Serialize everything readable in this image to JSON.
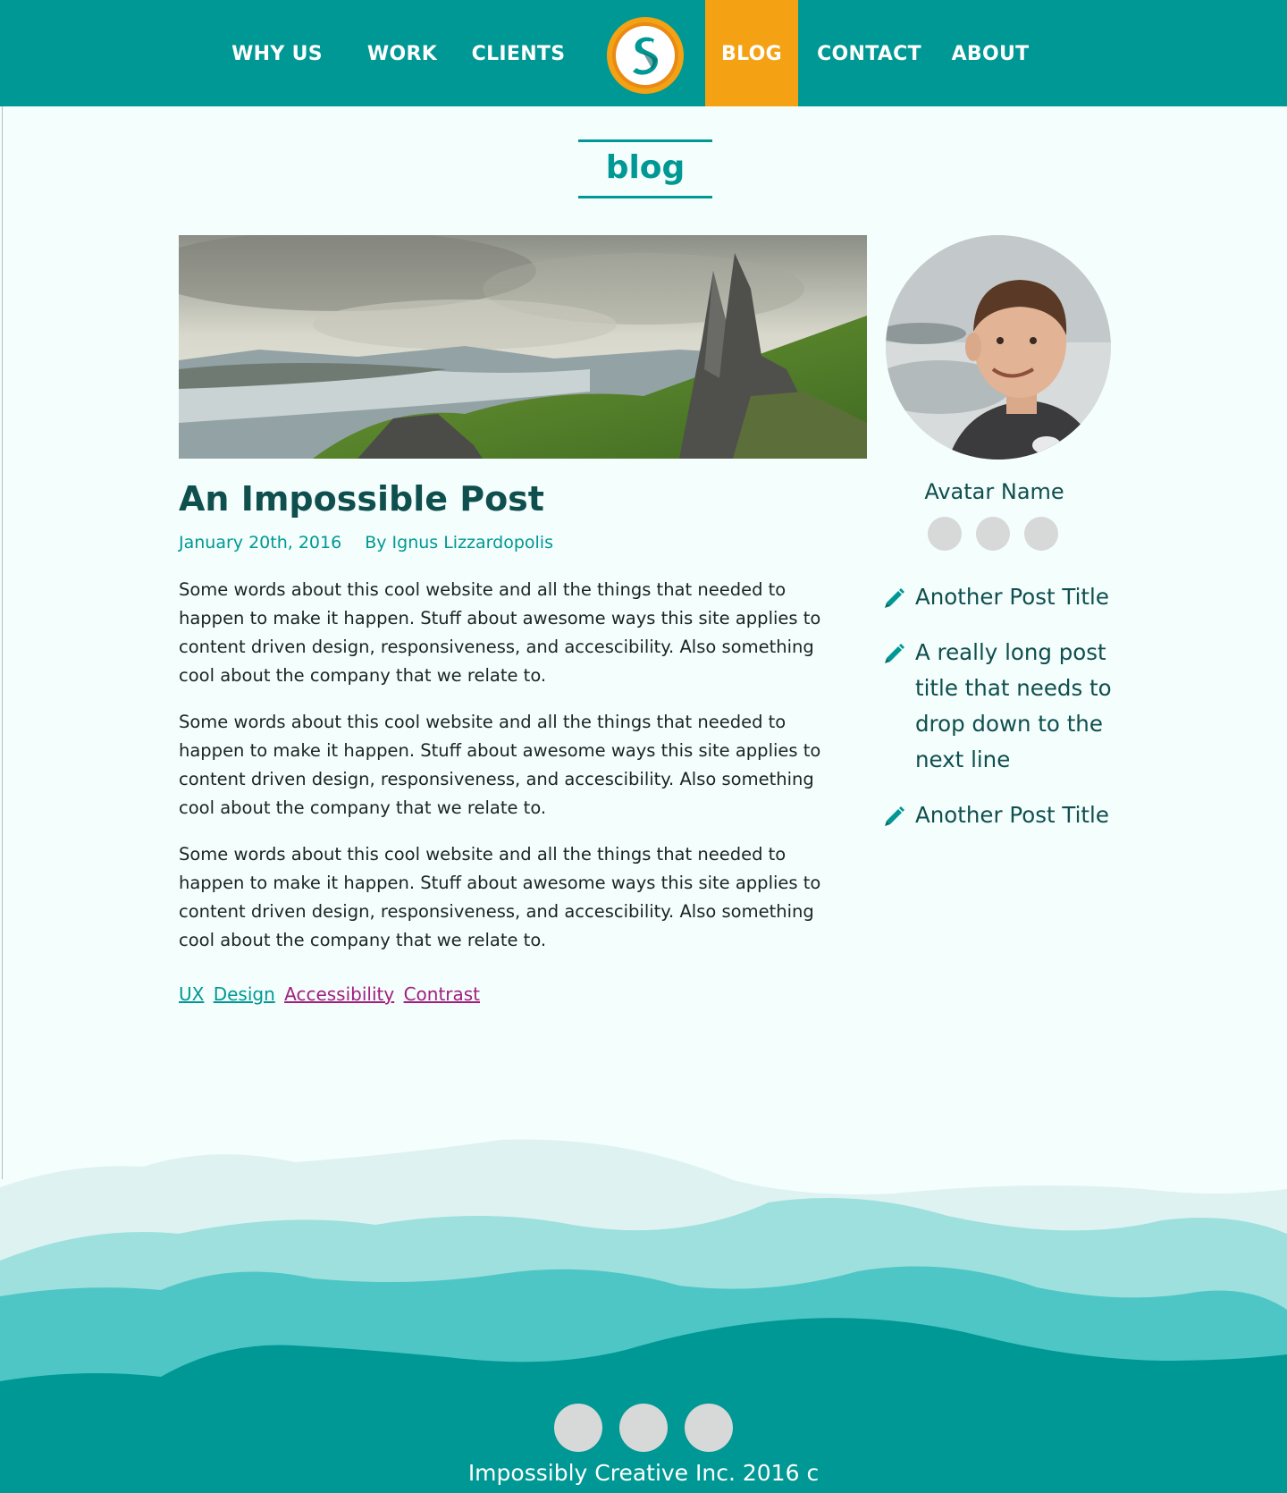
{
  "colors": {
    "brand": "#009894",
    "accent": "#f4a214",
    "tag_alt": "#a11f7e",
    "text_dark": "#0f4f4e"
  },
  "nav": {
    "items": [
      "WHY US",
      "WORK",
      "CLIENTS",
      "BLOG",
      "CONTACT",
      "ABOUT"
    ],
    "active": "BLOG",
    "logo_icon": "dragon-logo-icon"
  },
  "page": {
    "heading": "blog"
  },
  "post": {
    "title": "An Impossible Post",
    "date": "January 20th, 2016",
    "author": "By Ignus Lizzardopolis",
    "paragraphs": [
      "Some words about this cool website and all the things that needed to happen to make it happen. Stuff about awesome ways this site applies to content driven design, responsiveness, and accescibility. Also something cool about the company that we relate to.",
      "Some words about this cool website and all the things that needed to happen to make it happen. Stuff about awesome ways this site applies to content driven design, responsiveness, and accescibility. Also something cool about the company that we relate to.",
      "Some words about this cool website and all the things that needed to happen to make it happen. Stuff about awesome ways this site applies to content driven design, responsiveness, and accescibility. Also something cool about the company that we relate to."
    ],
    "tags": [
      "UX",
      "Design",
      "Accessibility",
      "Contrast"
    ]
  },
  "sidebar": {
    "avatar_name": "Avatar Name",
    "recent_icon": "pencil-icon",
    "recent_posts": [
      "Another Post Title",
      "A really long post title that needs to drop down to the next line",
      "Another Post Title"
    ]
  },
  "footer": {
    "copyright": "Impossibly Creative Inc. 2016 c"
  }
}
